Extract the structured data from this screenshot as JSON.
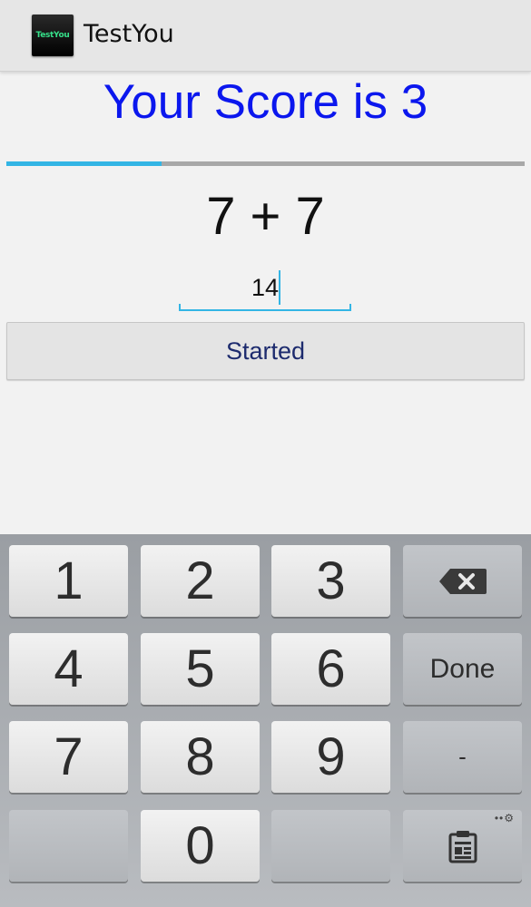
{
  "app": {
    "title": "TestYou",
    "icon_text": "TestYou"
  },
  "score": {
    "text": "Your Score is 3"
  },
  "progress": {
    "fraction": 0.3
  },
  "question": {
    "text": "7 + 7"
  },
  "answer": {
    "value": "14"
  },
  "start_button": {
    "label": "Started"
  },
  "keyboard": {
    "keys": {
      "k1": "1",
      "k2": "2",
      "k3": "3",
      "k4": "4",
      "k5": "5",
      "k6": "6",
      "k7": "7",
      "k8": "8",
      "k9": "9",
      "k0": "0",
      "done": "Done",
      "dash": "-"
    },
    "backspace_icon": "backspace-icon",
    "clipboard_icon": "clipboard-icon",
    "settings_icon": "settings-dots-icon"
  },
  "colors": {
    "score": "#0b17ee",
    "accent": "#33b5e5",
    "button_text": "#1d2b6e"
  }
}
